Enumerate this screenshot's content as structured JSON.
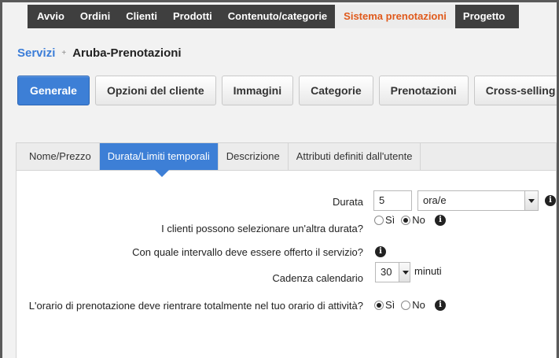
{
  "topnav": {
    "items": [
      "Avvio",
      "Ordini",
      "Clienti",
      "Prodotti",
      "Contenuto/categorie",
      "Sistema prenotazioni",
      "Progetto"
    ],
    "active_index": 5,
    "active_color": "#e05a1c"
  },
  "breadcrumb": {
    "link": "Servizi",
    "separator": "+",
    "current": "Aruba-Prenotazioni"
  },
  "main_tabs": {
    "items": [
      "Generale",
      "Opzioni del cliente",
      "Immagini",
      "Categorie",
      "Prenotazioni",
      "Cross-selling"
    ],
    "active_index": 0,
    "accent": "#3d7fd6"
  },
  "sub_tabs": {
    "items": [
      "Nome/Prezzo",
      "Durata/Limiti temporali",
      "Descrizione",
      "Attributi definiti dall'utente"
    ],
    "active_index": 1
  },
  "form": {
    "durata": {
      "label": "Durata",
      "value": "5",
      "unit_selected": "ora/e"
    },
    "altra_durata": {
      "label": "I clienti possono selezionare un'altra durata?",
      "option_yes": "Sì",
      "option_no": "No",
      "selected": "No"
    },
    "intervallo": {
      "label": "Con quale intervallo deve essere offerto il servizio?"
    },
    "cadenza": {
      "label": "Cadenza calendario",
      "value": "30",
      "unit": "minuti"
    },
    "orario": {
      "label": "L'orario di prenotazione deve rientrare totalmente nel tuo orario di attività?",
      "option_yes": "Sì",
      "option_no": "No",
      "selected": "Sì"
    }
  },
  "icons": {
    "info": "info-icon"
  }
}
